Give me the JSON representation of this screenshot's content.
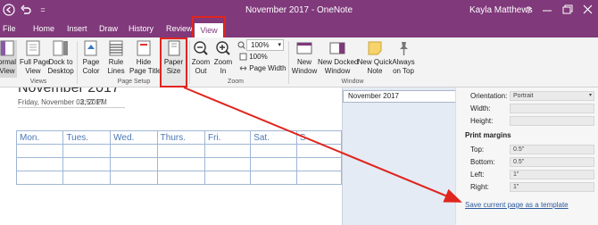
{
  "titlebar": {
    "document_title": "November 2017  -  OneNote",
    "user_name": "Kayla Matthews",
    "quick_access": {
      "more": "="
    }
  },
  "tabs": [
    "File",
    "Home",
    "Insert",
    "Draw",
    "History",
    "Review",
    "View"
  ],
  "active_tab": "View",
  "ribbon": {
    "views_group": {
      "label": "Views",
      "normal_view": "ormal\nView",
      "full_page_view": "Full Page\nView",
      "dock_to_desktop": "Dock to\nDesktop"
    },
    "page_setup_group": {
      "label": "Page Setup",
      "page_color": "Page\nColor",
      "rule_lines": "Rule\nLines",
      "hide_page_title": "Hide\nPage Title",
      "paper_size": "Paper\nSize"
    },
    "zoom_group": {
      "label": "Zoom",
      "zoom_out": "Zoom\nOut",
      "zoom_in": "Zoom\nIn",
      "zoom_value": "100%",
      "hundred_percent": "100%",
      "page_width": "Page Width"
    },
    "window_group": {
      "label": "Window",
      "new_window": "New\nWindow",
      "new_docked_window": "New Docked\nWindow",
      "new_quick_note": "New Quick\nNote",
      "always_on_top": "Always\non Top"
    }
  },
  "page": {
    "title": "November 2017",
    "date": "Friday, November 03, 2017",
    "time": "2:57 PM",
    "calendar_headers": [
      "Mon.",
      "Tues.",
      "Wed.",
      "Thurs.",
      "Fri.",
      "Sat.",
      "S"
    ]
  },
  "page_list": {
    "items": [
      "November 2017"
    ]
  },
  "paper_size_pane": {
    "orientation_label": "Orientation:",
    "orientation_value": "Portrait",
    "width_label": "Width:",
    "height_label": "Height:",
    "print_margins_heading": "Print margins",
    "margins": [
      {
        "label": "Top:",
        "value": "0.5\""
      },
      {
        "label": "Bottom:",
        "value": "0.5\""
      },
      {
        "label": "Left:",
        "value": "1\""
      },
      {
        "label": "Right:",
        "value": "1\""
      }
    ],
    "save_template_link": "Save current page as a template"
  },
  "colors": {
    "onenote_purple": "#80397b",
    "callout_red": "#e0251e",
    "calendar_blue": "#4a78b6",
    "link_blue": "#2e5c9e"
  }
}
